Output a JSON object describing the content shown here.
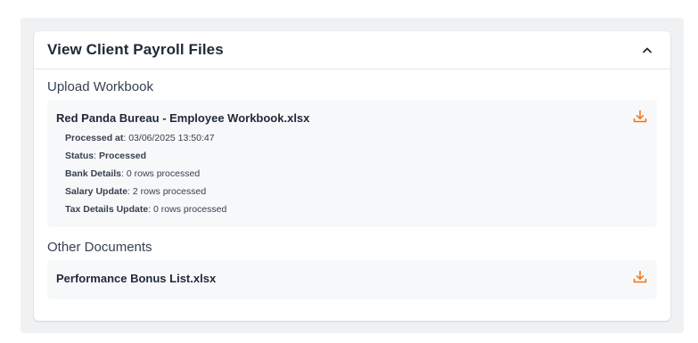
{
  "panel": {
    "title": "View Client Payroll Files"
  },
  "upload_section": {
    "title": "Upload Workbook",
    "file": {
      "name": "Red Panda Bureau - Employee Workbook.xlsx",
      "details": [
        {
          "label": "Processed at",
          "value": "03/06/2025 13:50:47"
        },
        {
          "label": "Status",
          "value": "Processed"
        },
        {
          "label": "Bank Details",
          "value": "0 rows processed"
        },
        {
          "label": "Salary Update",
          "value": "2 rows processed"
        },
        {
          "label": "Tax Details Update",
          "value": "0 rows processed"
        }
      ]
    }
  },
  "other_section": {
    "title": "Other Documents",
    "file": {
      "name": "Performance Bonus List.xlsx"
    }
  },
  "colors": {
    "accent": "#f97316",
    "card_bg": "#ffffff",
    "outer_bg": "#f0f1f3",
    "file_bg": "#f7f8f9"
  },
  "icons": {
    "collapse": "chevron-up-icon",
    "download": "download-icon"
  }
}
